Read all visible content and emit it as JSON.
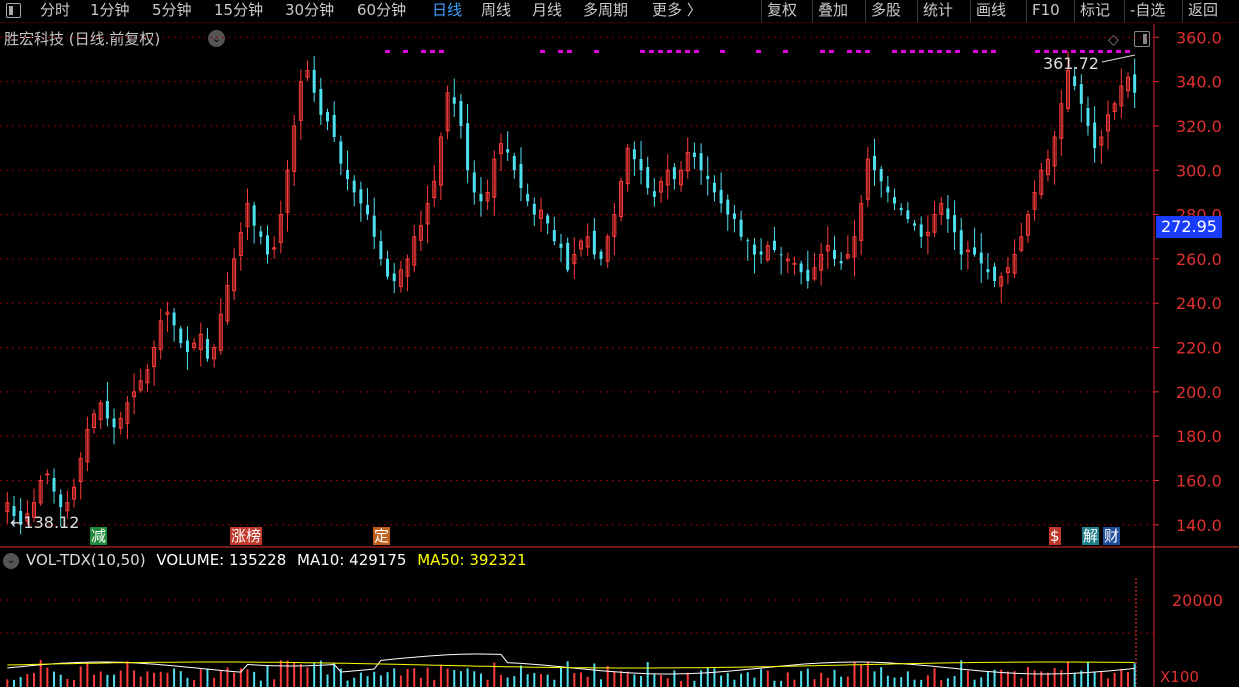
{
  "toolbar": {
    "tabs": [
      {
        "label": "分时",
        "active": false
      },
      {
        "label": "1分钟",
        "active": false
      },
      {
        "label": "5分钟",
        "active": false
      },
      {
        "label": "15分钟",
        "active": false
      },
      {
        "label": "30分钟",
        "active": false
      },
      {
        "label": "60分钟",
        "active": false
      },
      {
        "label": "日线",
        "active": true
      },
      {
        "label": "周线",
        "active": false
      },
      {
        "label": "月线",
        "active": false
      },
      {
        "label": "多周期",
        "active": false
      },
      {
        "label": "更多 〉",
        "active": false
      }
    ],
    "actions": [
      "复权",
      "叠加",
      "多股",
      "统计",
      "画线",
      "F10",
      "标记",
      "-自选",
      "返回"
    ]
  },
  "stock_title": "胜宏科技 (日线.前复权)",
  "price_box": "272.95",
  "max_label": "361.72",
  "min_label": "←138.12",
  "event_tags": [
    {
      "text": "减",
      "color": "#1f8a3a"
    },
    {
      "text": "涨榜",
      "color": "#c0392b"
    },
    {
      "text": "定",
      "color": "#c0601b"
    },
    {
      "text": "$",
      "color": "#c0392b"
    },
    {
      "text": "解",
      "color": "#1f7f8a"
    },
    {
      "text": "财",
      "color": "#1f4f9a"
    }
  ],
  "volume_indicator": {
    "name": "VOL-TDX(10,50)",
    "volume_label": "VOLUME: 135228",
    "ma10_label": "MA10: 429175",
    "ma50_label": "MA50: 392321"
  },
  "volume_multiplier": "X100",
  "colors": {
    "up": "#ff3b3b",
    "down": "#4fe0f0",
    "grid": "#8a0000",
    "axis": "#e03030",
    "ma10": "#ffffff",
    "ma50": "#ffff00",
    "marker": "#e000e0"
  },
  "chart_data": [
    {
      "type": "candlestick",
      "title": "胜宏科技 (日线.前复权)",
      "y_ticks": [
        140,
        160,
        180,
        200,
        220,
        240,
        260,
        280,
        300,
        320,
        340,
        360
      ],
      "ylim": [
        130,
        366
      ],
      "max": 361.72,
      "min": 138.12,
      "last_price": 272.95,
      "close_approx": [
        150,
        144,
        140,
        145,
        150,
        160,
        163,
        155,
        148,
        150,
        157,
        170,
        183,
        190,
        195,
        188,
        184,
        188,
        195,
        200,
        205,
        210,
        220,
        232,
        236,
        230,
        222,
        218,
        222,
        226,
        215,
        220,
        235,
        248,
        260,
        272,
        285,
        275,
        270,
        262,
        265,
        280,
        300,
        320,
        340,
        345,
        335,
        325,
        322,
        315,
        303,
        296,
        290,
        285,
        280,
        270,
        260,
        252,
        250,
        255,
        260,
        270,
        275,
        285,
        295,
        315,
        335,
        330,
        320,
        300,
        290,
        286,
        290,
        305,
        312,
        308,
        300,
        292,
        286,
        280,
        282,
        276,
        268,
        265,
        255,
        262,
        268,
        270,
        262,
        260,
        270,
        280,
        295,
        310,
        305,
        300,
        292,
        288,
        295,
        300,
        296,
        300,
        308,
        306,
        300,
        296,
        290,
        285,
        280,
        278,
        270,
        268,
        262,
        262,
        266,
        264,
        262,
        260,
        258,
        254,
        250,
        256,
        262,
        266,
        260,
        258,
        262,
        270,
        285,
        305,
        300,
        295,
        290,
        285,
        282,
        278,
        275,
        270,
        272,
        280,
        285,
        278,
        272,
        262,
        264,
        262,
        258,
        254,
        250,
        252,
        256,
        262,
        270,
        280,
        290,
        300,
        305,
        315,
        330,
        345,
        338,
        330,
        320,
        310,
        315,
        325,
        330,
        338,
        342,
        335
      ],
      "volume_ma10_approx": "line",
      "y_tick_volume": [
        20000
      ]
    }
  ]
}
